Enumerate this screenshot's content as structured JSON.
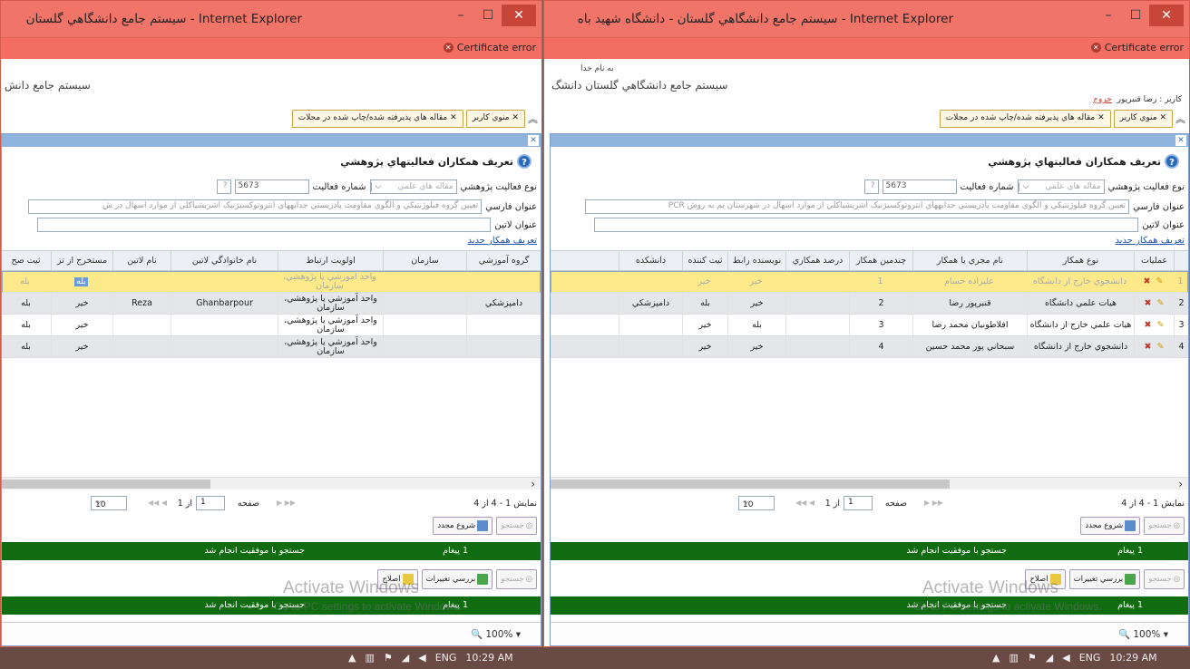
{
  "browser": {
    "left_title": "سيستم جامع دانشگاهي گلستان - Internet Explorer",
    "right_title": "سيستم جامع دانشگاهي گلستان - دانشگاه شهيد باه - Internet Explorer",
    "cert_error": "Certificate error",
    "zoom": "100%"
  },
  "page": {
    "basmala": "به نام خدا",
    "system_name_left": "سيستم جامع دانش",
    "system_name_right": "سيستم جامع دانشگاهي گلستان   دانشگ",
    "user_label": "کاربر : رضا قنبرپور",
    "logout": "خروج",
    "tabs": [
      "منوي کاربر",
      "مقاله هاي پذيرفته شده/چاپ شده در مجلات"
    ]
  },
  "form": {
    "heading": "تعريف همکاران فعاليتهاي پژوهشي",
    "activity_type_label": "نوع فعاليت پژوهشي",
    "activity_type_value": "مقاله هاي علمي",
    "activity_number_label": "شماره فعاليت",
    "activity_number": "5673",
    "persian_title_label": "عنوان فارسي",
    "persian_title_value_right": "تعيين گروه فيلوژنتيکي و الگوي مقاومت پادزيستي جدايههاي انتروتوکسيژنيک اشريشياکلي از موارد اسهال در شهرستان بم به روش PCR",
    "persian_title_value_left": "تعيين گروه فيلوژنتيکي و الگوي مقاومت پادزيستي جدايههاي انتروتوکسيژنيک اشريشياکلي از موارد اسهال در ش",
    "latin_title_label": "عنوان لاتين",
    "new_coworker_link": "تعريف همکار جديد"
  },
  "right_grid": {
    "headers": [
      "عمليات",
      "نوع همکار",
      "نام مجري يا همکار",
      "چندمين همکار",
      "درصد همکاري",
      "نويسنده رابط",
      "ثبت کننده",
      "دانشکده"
    ],
    "rows": [
      {
        "n": "1",
        "type": "دانشجوي خارج از دانشگاه",
        "name": "عليزاده حسام",
        "order": "1",
        "percent": "",
        "corresponding": "خير",
        "registrar": "خير",
        "faculty": ""
      },
      {
        "n": "2",
        "type": "هيات علمي دانشگاه",
        "name": "قنبرپور رضا",
        "order": "2",
        "percent": "",
        "corresponding": "خير",
        "registrar": "بله",
        "faculty": "دامپزشکي"
      },
      {
        "n": "3",
        "type": "هيات علمي خارج از دانشگاه",
        "name": "افلاطونيان محمد رضا",
        "order": "3",
        "percent": "",
        "corresponding": "بله",
        "registrar": "خير",
        "faculty": ""
      },
      {
        "n": "4",
        "type": "دانشجوي خارج از دانشگاه",
        "name": "سبحاني پور محمد حسين",
        "order": "4",
        "percent": "",
        "corresponding": "خير",
        "registrar": "خير",
        "faculty": ""
      }
    ]
  },
  "left_grid": {
    "headers": [
      "گروه آموزشي",
      "سازمان",
      "اولويت ارتباط",
      "نام خانوادگي لاتين",
      "نام لاتين",
      "مستخرج از تز",
      "ثبت صح"
    ],
    "rows": [
      {
        "group": "",
        "org": "",
        "priority": "واحد آموزشي يا پژوهشي، سازمان",
        "lastname": "",
        "firstname": "",
        "thesis": "بله",
        "registered": "بله"
      },
      {
        "group": "دامپزشکي",
        "org": "",
        "priority": "واحد آموزشي يا پژوهشي، سازمان",
        "lastname": "Ghanbarpour",
        "firstname": "Reza",
        "thesis": "خير",
        "registered": "بله"
      },
      {
        "group": "",
        "org": "",
        "priority": "واحد آموزشي يا پژوهشي، سازمان",
        "lastname": "",
        "firstname": "",
        "thesis": "خير",
        "registered": "بله"
      },
      {
        "group": "",
        "org": "",
        "priority": "واحد آموزشي يا پژوهشي، سازمان",
        "lastname": "",
        "firstname": "",
        "thesis": "خير",
        "registered": "بله"
      }
    ]
  },
  "pager": {
    "summary": "نمايش 1 - 4 از 4",
    "page_label": "صفحه",
    "page_value": "1",
    "of_label": "از 1",
    "page_size": "10"
  },
  "toolbar": {
    "search": "جستجو",
    "refresh": "شروع مجدد",
    "review": "بررسي تغييرات",
    "edit": "اصلاح"
  },
  "messages": {
    "count": "1 پيغام",
    "text": "جستجو با موفقيت انجام شد"
  },
  "watermark": {
    "line1": "Activate Windows",
    "line2": "Go to PC settings to activate Windows."
  },
  "taskbar": {
    "lang": "ENG",
    "time": "10:29 AM"
  }
}
